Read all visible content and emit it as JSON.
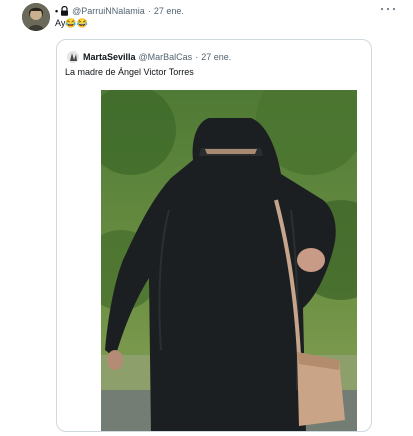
{
  "tweet": {
    "dot": "•",
    "handle": "@ParruiNNalamia",
    "separator": "·",
    "time": "27 ene.",
    "text": "Ay😂😂"
  },
  "quote": {
    "name": "MartaSevilla",
    "handle": "@MarBalCas",
    "separator": "·",
    "time": "27 ene.",
    "text": "La madre de Ángel Victor Torres"
  },
  "icons": {
    "lock": "lock-icon",
    "more": "more-options-icon"
  },
  "colors": {
    "text_primary": "#0f1419",
    "text_secondary": "#536471",
    "border": "#cfd9de"
  }
}
